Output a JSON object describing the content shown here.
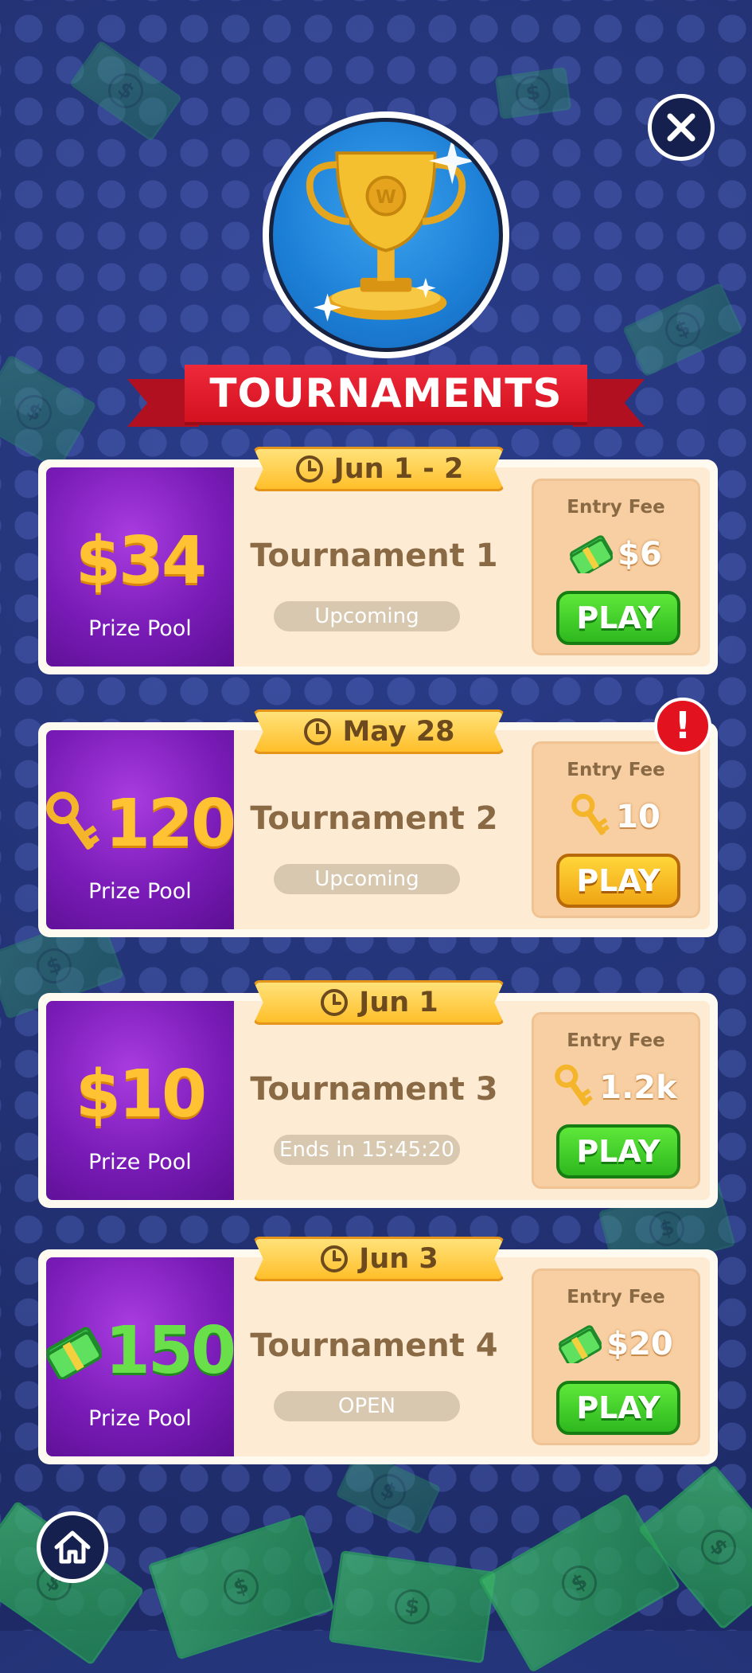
{
  "header": {
    "title": "TOURNAMENTS"
  },
  "tournaments": [
    {
      "date": "Jun 1 - 2",
      "prize_amount": "$34",
      "prize_icon": "none",
      "prize_label": "Prize Pool",
      "name": "Tournament 1",
      "status": "Upcoming",
      "fee_label": "Entry Fee",
      "fee_icon": "cash-icon",
      "fee_value": "$6",
      "play_label": "PLAY",
      "play_color": "green"
    },
    {
      "date": "May 28",
      "prize_amount": "120",
      "prize_icon": "key-icon",
      "prize_label": "Prize Pool",
      "name": "Tournament 2",
      "status": "Upcoming",
      "fee_label": "Entry Fee",
      "fee_icon": "key-icon",
      "fee_value": "10",
      "play_label": "PLAY",
      "play_color": "gold",
      "alert": "!"
    },
    {
      "date": "Jun 1",
      "prize_amount": "$10",
      "prize_icon": "none",
      "prize_label": "Prize Pool",
      "name": "Tournament 3",
      "status": "Ends in 15:45:20",
      "fee_label": "Entry Fee",
      "fee_icon": "key-icon",
      "fee_value": "1.2k",
      "play_label": "PLAY",
      "play_color": "green"
    },
    {
      "date": "Jun 3",
      "prize_amount": "150",
      "prize_icon": "cash-icon",
      "prize_label": "Prize Pool",
      "name": "Tournament 4",
      "status": "OPEN",
      "fee_label": "Entry Fee",
      "fee_icon": "cash-icon",
      "fee_value": "$20",
      "play_label": "PLAY",
      "play_color": "green"
    }
  ],
  "colors": {
    "background": "#243478",
    "prize_purple": "#7a1cb8",
    "play_green": "#2eb81e",
    "play_gold": "#f0a514",
    "ribbon_red": "#d4111f"
  }
}
